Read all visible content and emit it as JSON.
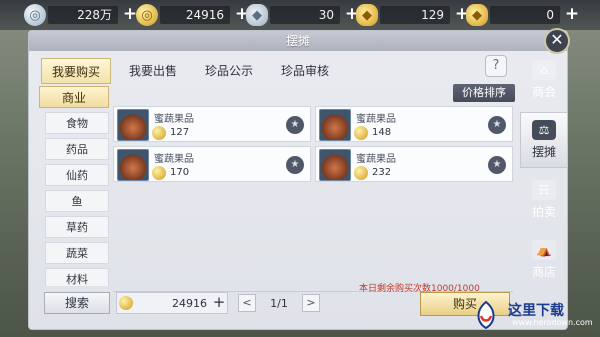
{
  "currencies": [
    {
      "name": "silver",
      "value": "228万"
    },
    {
      "name": "gold",
      "value": "24916"
    },
    {
      "name": "silver-ingot",
      "value": "30"
    },
    {
      "name": "gold-ingot",
      "value": "129"
    },
    {
      "name": "gold-ingot-2",
      "value": "0"
    }
  ],
  "title": "摆摊",
  "tabs": [
    "我要购买",
    "我要出售",
    "珍品公示",
    "珍品审核"
  ],
  "help": "?",
  "sort_label": "价格排序",
  "categories": {
    "header": "商业",
    "items": [
      "食物",
      "药品",
      "仙药",
      "鱼",
      "草药",
      "蔬菜",
      "材料"
    ]
  },
  "items": [
    {
      "name": "蜜蔬果品",
      "price": "127"
    },
    {
      "name": "蜜蔬果品",
      "price": "148"
    },
    {
      "name": "蜜蔬果品",
      "price": "170"
    },
    {
      "name": "蜜蔬果品",
      "price": "232"
    }
  ],
  "quota": "本日剩余购买次数1000/1000",
  "search_label": "搜索",
  "balance": "24916",
  "page": "1/1",
  "buy_label": "购买",
  "rail": [
    {
      "label": "商会",
      "icon": "shop-icon"
    },
    {
      "label": "摆摊",
      "icon": "stall-icon"
    },
    {
      "label": "拍卖",
      "icon": "auction-icon"
    },
    {
      "label": "商店",
      "icon": "store-icon"
    }
  ],
  "watermark": {
    "text": "这里下载",
    "url": "www.herodown.com"
  }
}
